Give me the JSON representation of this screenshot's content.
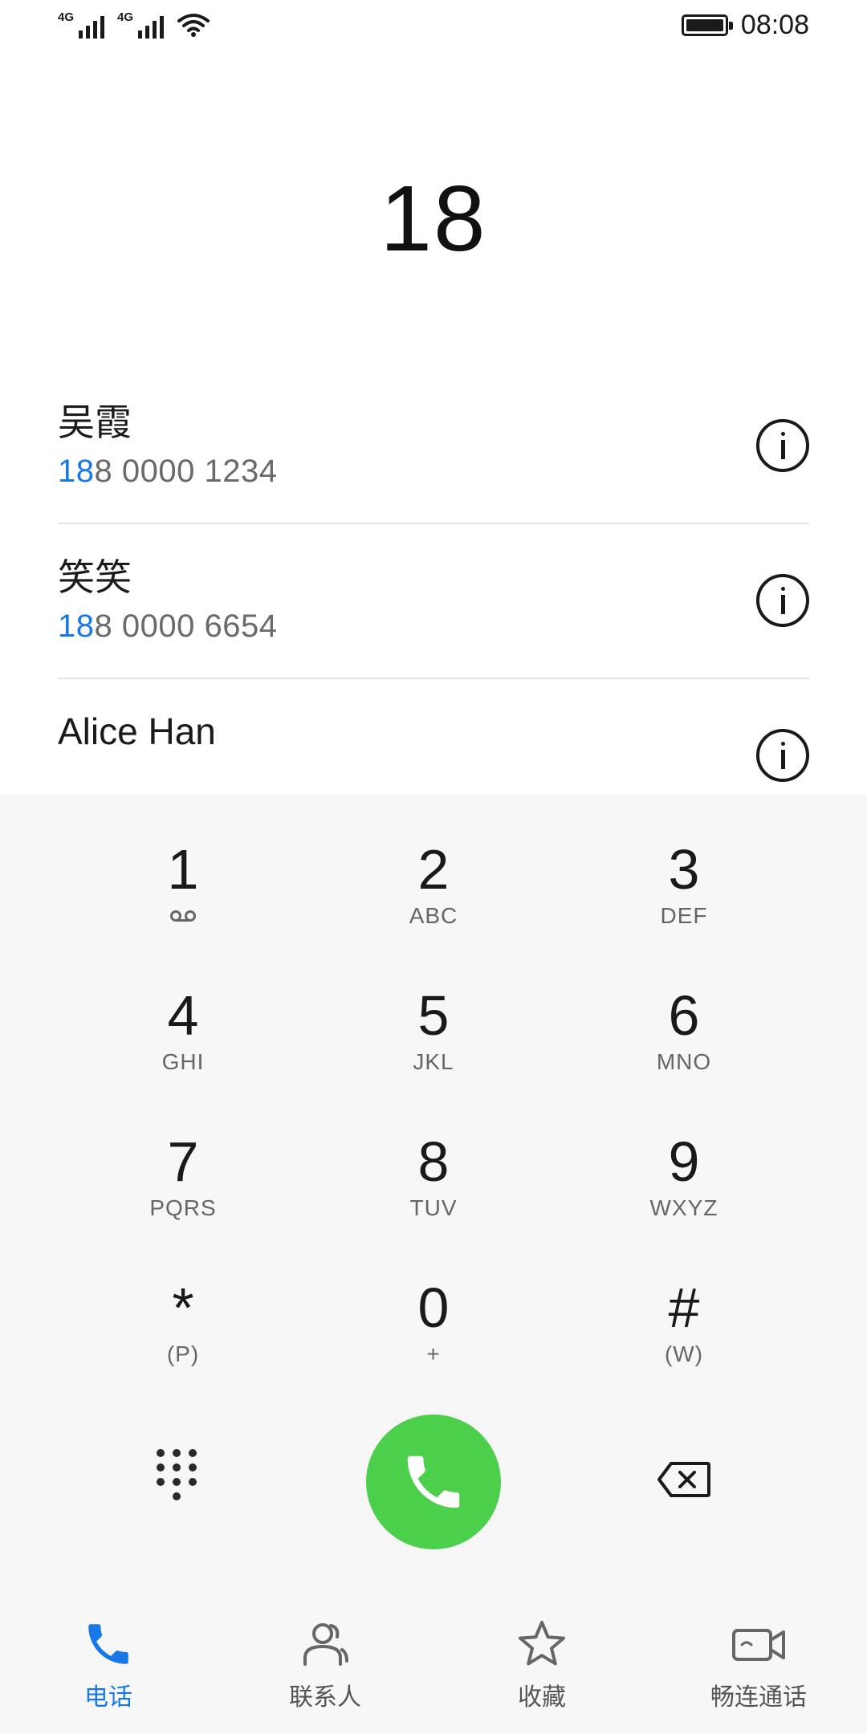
{
  "status_bar": {
    "signal_1_label": "4G",
    "signal_2_label": "4G",
    "time": "08:08",
    "battery_level": 1.0
  },
  "dialer": {
    "dialed_number": "18"
  },
  "results": [
    {
      "name": "吴霞",
      "number_match": "18",
      "number_rest": "8 0000 1234"
    },
    {
      "name": "笑笑",
      "number_match": "18",
      "number_rest": "8 0000 6654"
    },
    {
      "name": "Alice Han",
      "number_match": "",
      "number_rest": ""
    }
  ],
  "keypad": [
    {
      "digit": "1",
      "letters": ""
    },
    {
      "digit": "2",
      "letters": "ABC"
    },
    {
      "digit": "3",
      "letters": "DEF"
    },
    {
      "digit": "4",
      "letters": "GHI"
    },
    {
      "digit": "5",
      "letters": "JKL"
    },
    {
      "digit": "6",
      "letters": "MNO"
    },
    {
      "digit": "7",
      "letters": "PQRS"
    },
    {
      "digit": "8",
      "letters": "TUV"
    },
    {
      "digit": "9",
      "letters": "WXYZ"
    },
    {
      "digit": "*",
      "letters": "(P)"
    },
    {
      "digit": "0",
      "letters": "+"
    },
    {
      "digit": "#",
      "letters": "(W)"
    }
  ],
  "icons": {
    "voicemail": "voicemail-icon",
    "dialpad_toggle": "dialpad-icon",
    "call": "phone-icon",
    "backspace": "backspace-icon"
  },
  "nav": {
    "items": [
      {
        "label": "电话",
        "icon": "phone-icon",
        "active": true
      },
      {
        "label": "联系人",
        "icon": "contacts-icon",
        "active": false
      },
      {
        "label": "收藏",
        "icon": "star-icon",
        "active": false
      },
      {
        "label": "畅连通话",
        "icon": "video-call-icon",
        "active": false
      }
    ]
  },
  "colors": {
    "accent": "#1878e8",
    "call_green": "#4cd04c",
    "dialpad_bg": "#f7f7f7",
    "text_primary": "#1a1a1a",
    "text_secondary": "#6a6a6a"
  }
}
